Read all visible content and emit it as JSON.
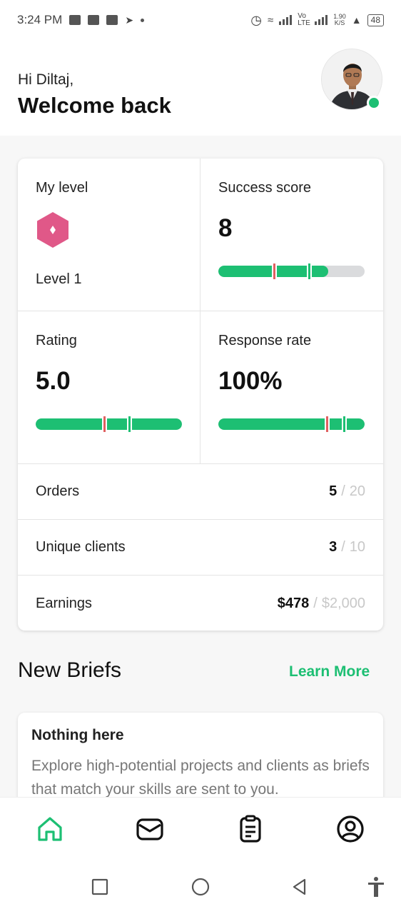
{
  "status_bar": {
    "time": "3:24 PM",
    "network_speed": "1.90",
    "network_speed_unit": "K/S",
    "battery": "48",
    "volte": "Vo LTE"
  },
  "header": {
    "greeting": "Hi Diltaj,",
    "welcome": "Welcome back",
    "online_color": "#1dbf73"
  },
  "stats": {
    "level": {
      "label": "My level",
      "value": "Level 1",
      "badge_color": "#e05888"
    },
    "success_score": {
      "label": "Success score",
      "value": "8",
      "progress": 0.75,
      "markers": [
        0.38,
        0.62
      ]
    },
    "rating": {
      "label": "Rating",
      "value": "5.0",
      "progress": 1.0,
      "markers": [
        0.47,
        0.64
      ]
    },
    "response_rate": {
      "label": "Response rate",
      "value": "100%",
      "progress": 1.0,
      "markers": [
        0.74,
        0.86
      ]
    },
    "rows": [
      {
        "label": "Orders",
        "value": "5",
        "separator": "/",
        "target": "20"
      },
      {
        "label": "Unique clients",
        "value": "3",
        "separator": "/",
        "target": "10"
      },
      {
        "label": "Earnings",
        "value": "$478",
        "separator": "/",
        "target": "$2,000"
      }
    ]
  },
  "briefs": {
    "title": "New Briefs",
    "learn_more": "Learn More",
    "empty_title": "Nothing here",
    "empty_text": "Explore high-potential projects and clients as briefs that match your skills are sent to you."
  },
  "bottom_nav": {
    "items": [
      {
        "icon": "home-icon",
        "active": true
      },
      {
        "icon": "mail-icon",
        "active": false
      },
      {
        "icon": "orders-icon",
        "active": false
      },
      {
        "icon": "profile-icon",
        "active": false
      }
    ]
  },
  "colors": {
    "accent": "#1dbf73",
    "marker_red": "#e06060",
    "track": "#dadbdd"
  }
}
